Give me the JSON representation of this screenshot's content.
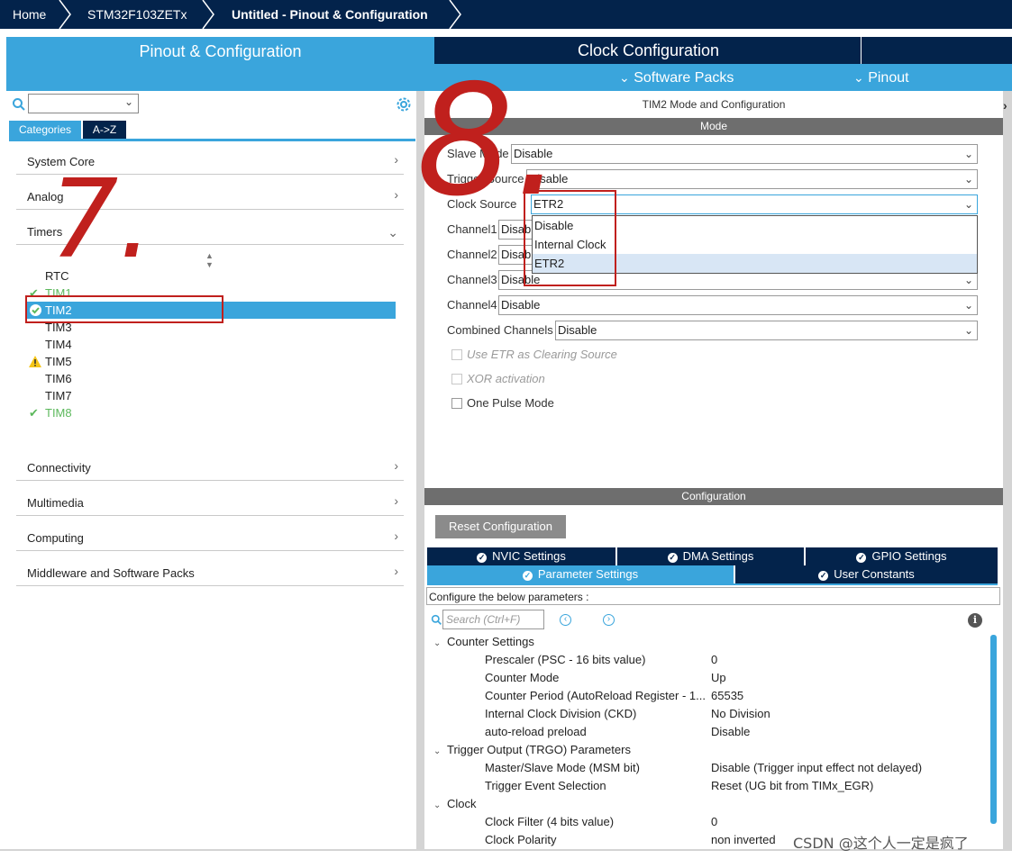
{
  "breadcrumb": [
    "Home",
    "STM32F103ZETx",
    "Untitled - Pinout & Configuration"
  ],
  "top_tabs": {
    "pinout_config": "Pinout & Configuration",
    "clock_config": "Clock Configuration",
    "software_packs": "Software Packs",
    "pinout": "Pinout"
  },
  "left": {
    "tabs": [
      "Categories",
      "A->Z"
    ],
    "categories": [
      "System Core",
      "Analog",
      "Timers",
      "Connectivity",
      "Multimedia",
      "Computing",
      "Middleware and Software Packs"
    ],
    "timers": [
      {
        "name": "RTC",
        "status": ""
      },
      {
        "name": "TIM1",
        "status": "ok"
      },
      {
        "name": "TIM2",
        "status": "selected"
      },
      {
        "name": "TIM3",
        "status": ""
      },
      {
        "name": "TIM4",
        "status": ""
      },
      {
        "name": "TIM5",
        "status": "warning"
      },
      {
        "name": "TIM6",
        "status": ""
      },
      {
        "name": "TIM7",
        "status": ""
      },
      {
        "name": "TIM8",
        "status": "ok"
      }
    ]
  },
  "mode": {
    "title": "TIM2 Mode and Configuration",
    "header": "Mode",
    "slave_mode": {
      "label": "Slave Mode",
      "value": "Disable"
    },
    "trigger_source": {
      "label": "Trigger Source",
      "value": "Disable"
    },
    "clock_source": {
      "label": "Clock Source",
      "value": "ETR2"
    },
    "channel1": {
      "label": "Channel1",
      "value": "Disable"
    },
    "channel2": {
      "label": "Channel2",
      "value": "Disable"
    },
    "channel3": {
      "label": "Channel3",
      "value": "Disable"
    },
    "channel4": {
      "label": "Channel4",
      "value": "Disable"
    },
    "combined": {
      "label": "Combined Channels",
      "value": "Disable"
    },
    "dropdown_options": [
      "Disable",
      "Internal Clock",
      "ETR2"
    ],
    "checkboxes": [
      "Use ETR as Clearing Source",
      "XOR activation",
      "One Pulse Mode"
    ]
  },
  "config": {
    "header": "Configuration",
    "reset_button": "Reset Configuration",
    "tabs_row1": [
      "NVIC Settings",
      "DMA Settings",
      "GPIO Settings"
    ],
    "tabs_row2": [
      "Parameter Settings",
      "User Constants"
    ],
    "note": "Configure the below parameters :",
    "search_placeholder": "Search (Ctrl+F)",
    "groups": [
      {
        "title": "Counter Settings",
        "params": [
          {
            "name": "Prescaler (PSC - 16 bits value)",
            "value": "0"
          },
          {
            "name": "Counter Mode",
            "value": "Up"
          },
          {
            "name": "Counter Period (AutoReload Register - 1...",
            "value": "65535"
          },
          {
            "name": "Internal Clock Division (CKD)",
            "value": "No Division"
          },
          {
            "name": "auto-reload preload",
            "value": "Disable"
          }
        ]
      },
      {
        "title": "Trigger Output (TRGO) Parameters",
        "params": [
          {
            "name": "Master/Slave Mode (MSM bit)",
            "value": "Disable (Trigger input effect not delayed)"
          },
          {
            "name": "Trigger Event Selection",
            "value": "Reset (UG bit from TIMx_EGR)"
          }
        ]
      },
      {
        "title": "Clock",
        "params": [
          {
            "name": "Clock Filter (4 bits value)",
            "value": "0"
          },
          {
            "name": "Clock Polarity",
            "value": "non inverted"
          }
        ]
      }
    ]
  },
  "annotations": {
    "label_7": "7.",
    "label_8": "8."
  },
  "watermark": "CSDN @这个人一定是疯了",
  "colors": {
    "navy": "#03234b",
    "accent": "#3aa5dc",
    "ok_green": "#5cb85c",
    "warn_yellow": "#f5c518",
    "annotation_red": "#c0201d"
  }
}
